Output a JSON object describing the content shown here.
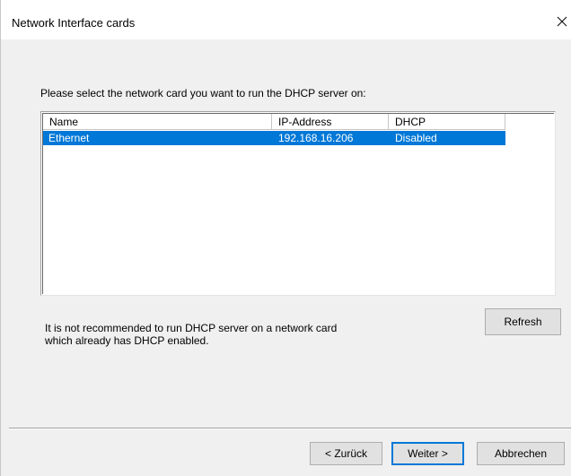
{
  "window": {
    "title": "Network Interface cards"
  },
  "instruction": "Please select the network card you want to run the DHCP server on:",
  "list": {
    "columns": [
      "Name",
      "IP-Address",
      "DHCP"
    ],
    "rows": [
      {
        "name": "Ethernet",
        "ip": "192.168.16.206",
        "dhcp": "Disabled",
        "selected": true
      }
    ]
  },
  "warning": "It is not recommended to run DHCP server on a network card\nwhich already has DHCP enabled.",
  "buttons": {
    "refresh": "Refresh",
    "back": "< Zurück",
    "next": "Weiter >",
    "cancel": "Abbrechen"
  },
  "colors": {
    "selection": "#0078d7",
    "window_bg": "#f0f0f0",
    "title_bg": "#ffffff"
  },
  "icons": {
    "close": "close-icon"
  }
}
